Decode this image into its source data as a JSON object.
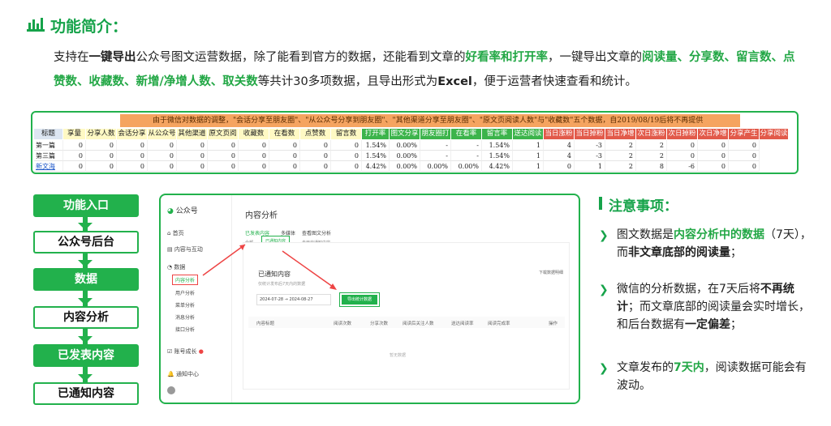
{
  "header": {
    "title": "功能简介：",
    "title_icon": "chart-icon"
  },
  "intro": {
    "p1": "支持在",
    "p2": "一键导出",
    "p3": "公众号图文运营数据，除了能看到官方的数据，还能看到文章的",
    "p4": "好看率和打开率",
    "p5": "，一键导出文章的",
    "p6": "阅读量、分享数、留言数、点赞数、收藏数、新增/净增人数、取关数",
    "p7": "等共计30多项数据，且导出形式为",
    "p8": "Excel",
    "p9": "，便于运营者快速查看和统计。"
  },
  "sheet": {
    "banner": "由于微信对数据的调整，\"会话分享至朋友圈\"、\"从公众号分享到朋友圈\"、\"其他渠道分享至朋友圈\"、\"原文页阅读人数\"与\"收藏数\"五个数据，自2019/08/19后将不再提供",
    "headers": [
      "标题",
      "享量",
      "分享人数",
      "会话分享",
      "从公众号",
      "其他渠道",
      "原文页阅",
      "收藏数",
      "在看数",
      "点赞数",
      "留言数",
      "打开率",
      "图文分享",
      "朋友圈打",
      "在看率",
      "留言率",
      "送达阅读",
      "当日涨粉",
      "当日掉粉",
      "当日净增",
      "次日涨粉",
      "次日掉粉",
      "次日净增",
      "分享产生",
      "分享阅读"
    ],
    "rows": [
      [
        "第一篇",
        "0",
        "0",
        "0",
        "0",
        "0",
        "0",
        "0",
        "0",
        "0",
        "0",
        "1.54%",
        "0.00%",
        "-",
        "-",
        "1.54%",
        "1",
        "4",
        "-3",
        "2",
        "2",
        "0",
        "0",
        "0"
      ],
      [
        "第三篇",
        "0",
        "0",
        "0",
        "0",
        "0",
        "0",
        "0",
        "0",
        "0",
        "0",
        "1.54%",
        "0.00%",
        "-",
        "-",
        "1.54%",
        "1",
        "4",
        "-3",
        "2",
        "2",
        "0",
        "0",
        "0"
      ],
      [
        "新文海",
        "0",
        "0",
        "0",
        "0",
        "0",
        "0",
        "0",
        "0",
        "0",
        "0",
        "4.42%",
        "0.00%",
        "0.00%",
        "0.00%",
        "4.42%",
        "1",
        "0",
        "1",
        "2",
        "8",
        "-6",
        "0",
        "0"
      ]
    ]
  },
  "flow": {
    "steps": [
      "功能入口",
      "公众号后台",
      "数据",
      "内容分析",
      "已发表内容",
      "已通知内容"
    ]
  },
  "admin": {
    "brand": "公众号",
    "nav": [
      "首页",
      "内容与互动",
      "数据",
      "内容分析",
      "用户分析",
      "菜单分析",
      "消息分析",
      "接口分析",
      "账号成长",
      "通知中心"
    ],
    "page_title": "内容分析",
    "tabs": [
      "已发表内容",
      "多媒体",
      "查看图文分析"
    ],
    "subtabs": [
      "全部",
      "已通知内容",
      "未开启通知内容"
    ],
    "section_title": "已通知内容",
    "section_sub": "仅统计发布后7天内的数据",
    "download": "下载数据明细",
    "date_from": "2024-07-28",
    "date_to": "2024-08-27",
    "export_btn": "导出统计数据",
    "cols": [
      "内容标题",
      "阅读次数",
      "分享次数",
      "阅读后关注人数",
      "送达阅读率",
      "阅读完成率",
      "操作"
    ],
    "empty": "暂无数据"
  },
  "notes": {
    "title": "注意事项：",
    "n1a": "图文数据是",
    "n1b": "内容分析中的数据",
    "n1c": "（7天），而",
    "n1d": "非文章底部的阅读量",
    "n1e": "；",
    "n2a": "微信的分析数据，在7天后将",
    "n2b": "不再统计",
    "n2c": "；而文章底部的阅读量会实时增长，和后台数据有",
    "n2d": "一定偏差",
    "n2e": "；",
    "n3a": "文章发布的",
    "n3b": "7天内",
    "n3c": "，阅读数据可能会有波动。"
  },
  "colors": {
    "accent": "#22b14c",
    "banner": "#f5a460",
    "hdr_green": "#3cb44b",
    "hdr_red": "#e25a4a"
  }
}
